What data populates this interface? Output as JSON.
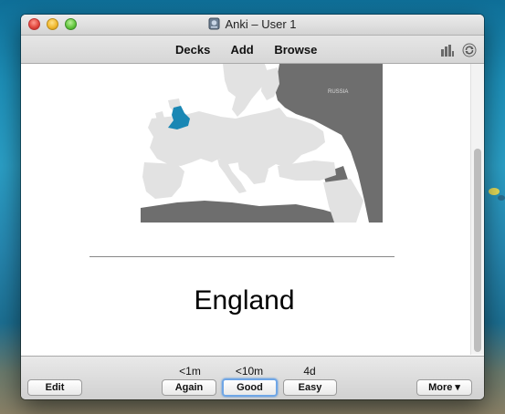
{
  "window": {
    "title": "Anki – User 1"
  },
  "toolbar": {
    "decks": "Decks",
    "add": "Add",
    "browse": "Browse"
  },
  "card": {
    "map_label": "RUSSIA",
    "answer": "England",
    "highlight_color": "#1a87b4"
  },
  "answer_buttons": [
    {
      "interval": "<1m",
      "label": "Again"
    },
    {
      "interval": "<10m",
      "label": "Good"
    },
    {
      "interval": "4d",
      "label": "Easy"
    }
  ],
  "bottom": {
    "edit": "Edit",
    "more": "More ▾"
  }
}
